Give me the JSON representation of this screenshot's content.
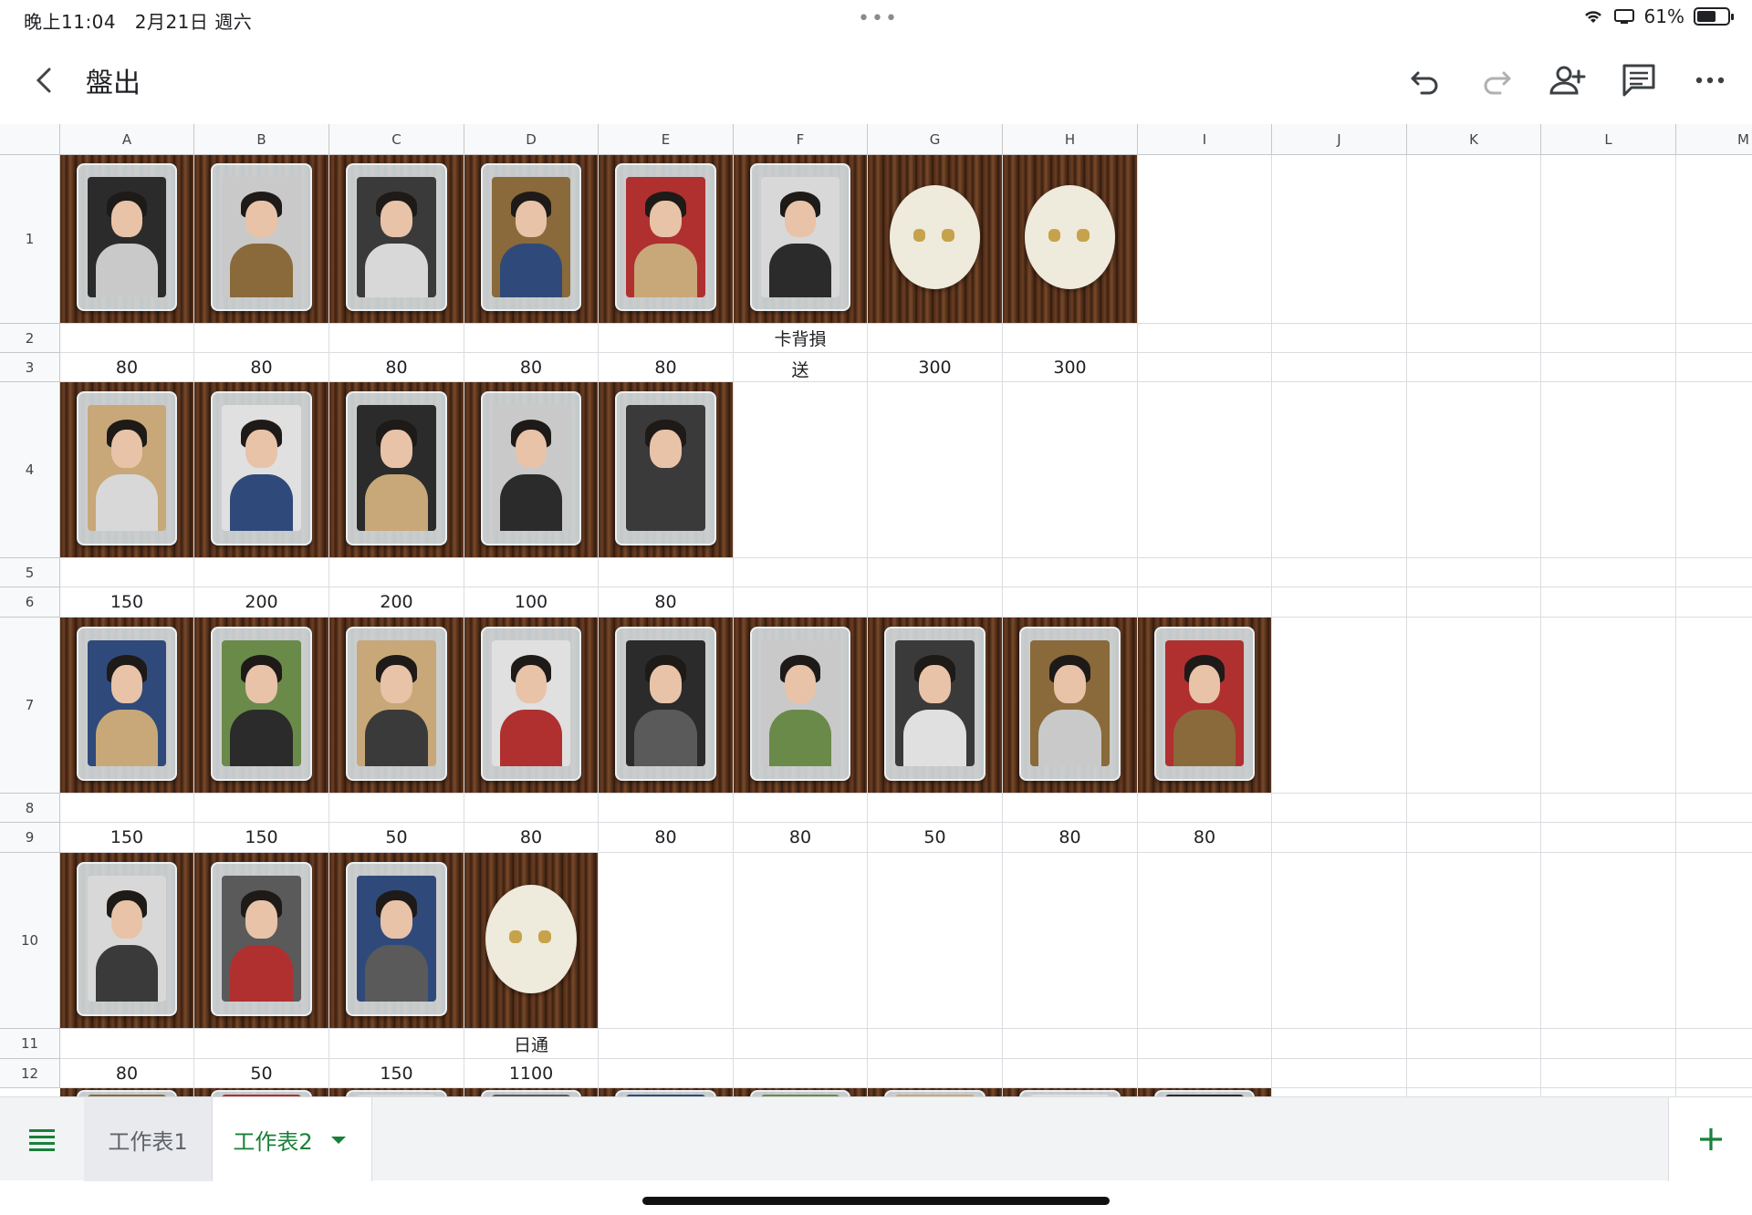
{
  "status_bar": {
    "time": "晚上11:04",
    "date": "2月21日 週六",
    "dots": "•••",
    "battery": "61%",
    "battery_level": 0.61
  },
  "header": {
    "title": "盤出",
    "icons": [
      "back-icon",
      "undo-icon",
      "redo-icon",
      "share-person-icon",
      "comment-icon",
      "more-icon"
    ]
  },
  "sheet": {
    "columns": [
      "A",
      "B",
      "C",
      "D",
      "E",
      "F",
      "G",
      "H",
      "I",
      "J",
      "K",
      "L",
      "M"
    ],
    "rows": [
      "1",
      "2",
      "3",
      "4",
      "5",
      "6",
      "7",
      "8",
      "9",
      "10",
      "11",
      "12"
    ],
    "cells": {
      "F2": "卡背損",
      "A3": "80",
      "B3": "80",
      "C3": "80",
      "D3": "80",
      "E3": "80",
      "F3": "送",
      "G3": "300",
      "H3": "300",
      "A6": "150",
      "B6": "200",
      "C6": "200",
      "D6": "100",
      "E6": "80",
      "A9": "150",
      "B9": "150",
      "C9": "50",
      "D9": "80",
      "E9": "80",
      "F9": "80",
      "G9": "50",
      "H9": "80",
      "I9": "80",
      "D11": "日通",
      "A12": "80",
      "B12": "50",
      "C12": "150",
      "D12": "1100"
    }
  },
  "tabs": {
    "sheet1": "工作表1",
    "sheet2": "工作表2",
    "menu_icon": "list-icon",
    "add_icon": "plus-icon",
    "dropdown_icon": "triangle-down-icon"
  },
  "colors": {
    "accent": "#188038",
    "header_bg": "#f8f9fa",
    "gridline": "#dadce0"
  }
}
